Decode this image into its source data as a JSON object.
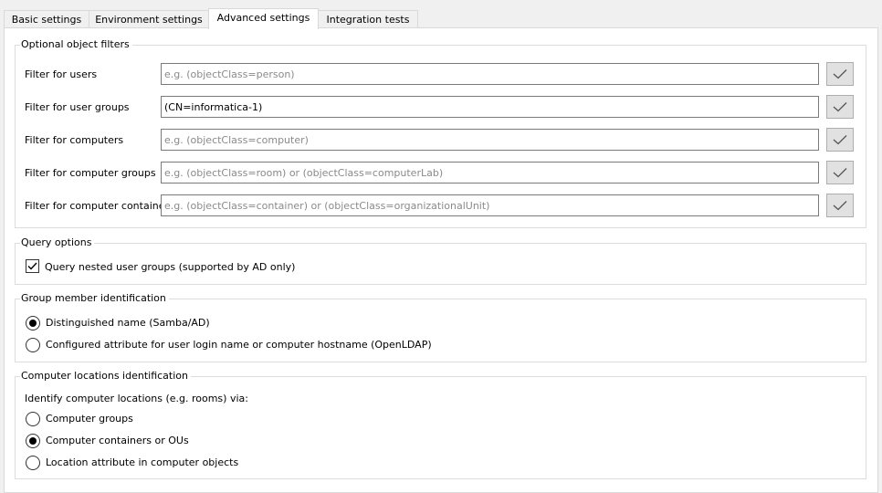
{
  "tabs": [
    {
      "label": "Basic settings"
    },
    {
      "label": "Environment settings"
    },
    {
      "label": "Advanced settings"
    },
    {
      "label": "Integration tests"
    }
  ],
  "active_tab": "Advanced settings",
  "object_filters": {
    "title": "Optional object filters",
    "rows": [
      {
        "label": "Filter for users",
        "value": "",
        "placeholder": "e.g. (objectClass=person)"
      },
      {
        "label": "Filter for user groups",
        "value": "(CN=informatica-1)",
        "placeholder": ""
      },
      {
        "label": "Filter for computers",
        "value": "",
        "placeholder": "e.g. (objectClass=computer)"
      },
      {
        "label": "Filter for computer groups",
        "value": "",
        "placeholder": "e.g. (objectClass=room) or (objectClass=computerLab)"
      },
      {
        "label": "Filter for computer containers",
        "value": "",
        "placeholder": "e.g. (objectClass=container) or (objectClass=organizationalUnit)"
      }
    ],
    "test_button_icon": "checkmark-icon"
  },
  "query_options": {
    "title": "Query options",
    "nested_groups_label": "Query nested user groups (supported by AD only)",
    "nested_groups_checked": true
  },
  "group_member": {
    "title": "Group member identification",
    "options": [
      {
        "label": "Distinguished name (Samba/AD)",
        "selected": true
      },
      {
        "label": "Configured attribute for user login name or computer hostname (OpenLDAP)",
        "selected": false
      }
    ]
  },
  "computer_locations": {
    "title": "Computer locations identification",
    "intro": "Identify computer locations (e.g. rooms) via:",
    "options": [
      {
        "label": "Computer groups",
        "selected": false
      },
      {
        "label": "Computer containers or OUs",
        "selected": true
      },
      {
        "label": "Location attribute in computer objects",
        "selected": false
      }
    ]
  },
  "colors": {
    "window_bg": "#f0f0f0",
    "panel_bg": "#ffffff",
    "border": "#dcdcdc",
    "placeholder_text": "#8a8a8a",
    "button_bg": "#e1e1e1"
  }
}
